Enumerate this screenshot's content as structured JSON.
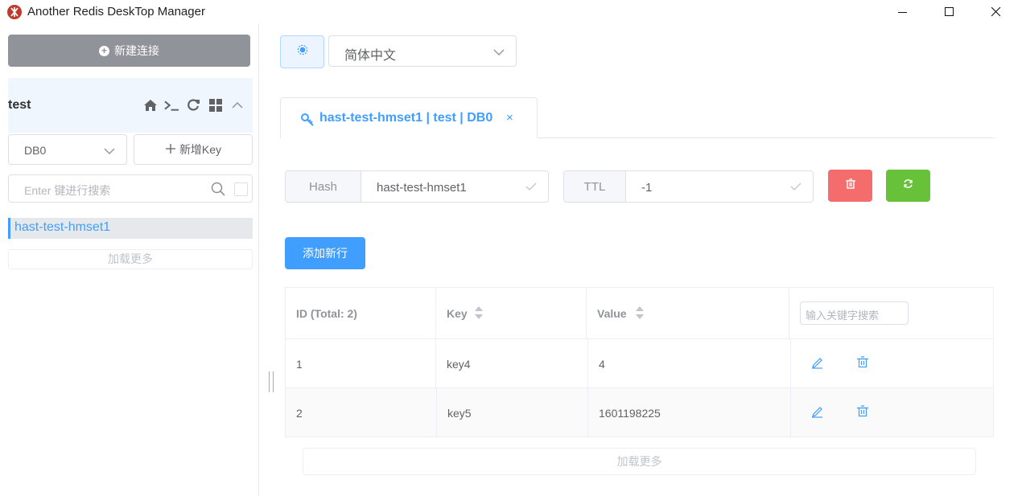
{
  "window": {
    "title": "Another Redis DeskTop Manager"
  },
  "sidebar": {
    "new_connection_label": "新建连接",
    "connection_name": "test",
    "db_select_value": "DB0",
    "add_key_label": "新增Key",
    "search_placeholder": "Enter 键进行搜索",
    "keys": [
      "hast-test-hmset1"
    ],
    "load_more_label": "加载更多"
  },
  "top": {
    "language_value": "简体中文"
  },
  "tab": {
    "label": "hast-test-hmset1 | test | DB0",
    "close_glyph": "×"
  },
  "key_header": {
    "type_label": "Hash",
    "key_name": "hast-test-hmset1",
    "ttl_label": "TTL",
    "ttl_value": "-1"
  },
  "add_row_label": "添加新行",
  "table": {
    "headers": {
      "id": "ID (Total: 2)",
      "key": "Key",
      "value": "Value"
    },
    "filter_placeholder": "输入关键字搜索",
    "rows": [
      {
        "id": "1",
        "key": "key4",
        "value": "4"
      },
      {
        "id": "2",
        "key": "key5",
        "value": "1601198225"
      }
    ],
    "load_more_label": "加载更多"
  },
  "colors": {
    "primary": "#409eff",
    "danger": "#f56c6c",
    "success": "#67c23a",
    "info": "#909399"
  }
}
